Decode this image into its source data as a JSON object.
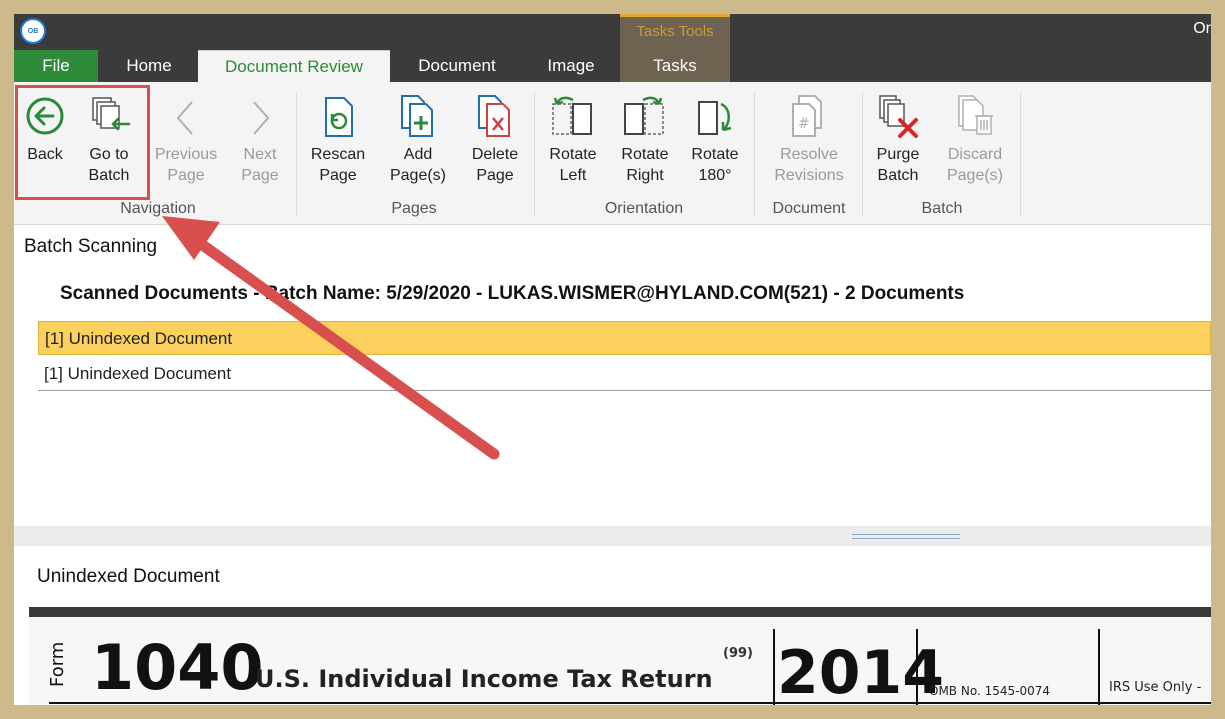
{
  "window": {
    "title_partial": "Or"
  },
  "contextual_group": {
    "label": "Tasks Tools"
  },
  "tabs": [
    {
      "label": "File"
    },
    {
      "label": "Home"
    },
    {
      "label": "Document Review"
    },
    {
      "label": "Document"
    },
    {
      "label": "Image"
    },
    {
      "label": "Tasks"
    }
  ],
  "ribbon": {
    "navigation": {
      "label": "Navigation",
      "back": {
        "line1": "Back",
        "line2": ""
      },
      "go_to_batch": {
        "line1": "Go to",
        "line2": "Batch"
      },
      "previous_page": {
        "line1": "Previous",
        "line2": "Page"
      },
      "next_page": {
        "line1": "Next",
        "line2": "Page"
      }
    },
    "pages": {
      "label": "Pages",
      "rescan": {
        "line1": "Rescan",
        "line2": "Page"
      },
      "add": {
        "line1": "Add",
        "line2": "Page(s)"
      },
      "delete": {
        "line1": "Delete",
        "line2": "Page"
      }
    },
    "orientation": {
      "label": "Orientation",
      "rotate_left": {
        "line1": "Rotate",
        "line2": "Left"
      },
      "rotate_right": {
        "line1": "Rotate",
        "line2": "Right"
      },
      "rotate_180": {
        "line1": "Rotate",
        "line2": "180°"
      }
    },
    "document": {
      "label": "Document",
      "resolve": {
        "line1": "Resolve",
        "line2": "Revisions"
      }
    },
    "batch": {
      "label": "Batch",
      "purge": {
        "line1": "Purge",
        "line2": "Batch"
      },
      "discard": {
        "line1": "Discard",
        "line2": "Page(s)"
      }
    }
  },
  "batch_scanning": {
    "title": "Batch Scanning",
    "header": "Scanned Documents - Batch Name: 5/29/2020 - LUKAS.WISMER@HYLAND.COM(521) - 2 Documents",
    "rows": [
      {
        "label": "[1] Unindexed Document",
        "selected": true
      },
      {
        "label": "[1] Unindexed Document",
        "selected": false
      }
    ]
  },
  "viewer": {
    "title": "Unindexed Document",
    "form_word": "Form",
    "form_number": "1040",
    "form_title": "U.S. Individual Income Tax Return",
    "form_code": "(99)",
    "year": "2014",
    "omb": "OMB No. 1545-0074",
    "irs_use": "IRS Use Only -"
  },
  "colors": {
    "highlight_box": "#d8504d",
    "arrow": "#d8504d",
    "selected_row": "#fbd05c",
    "accent_green": "#2a8a3a",
    "file_tab": "#2e8b3a"
  }
}
